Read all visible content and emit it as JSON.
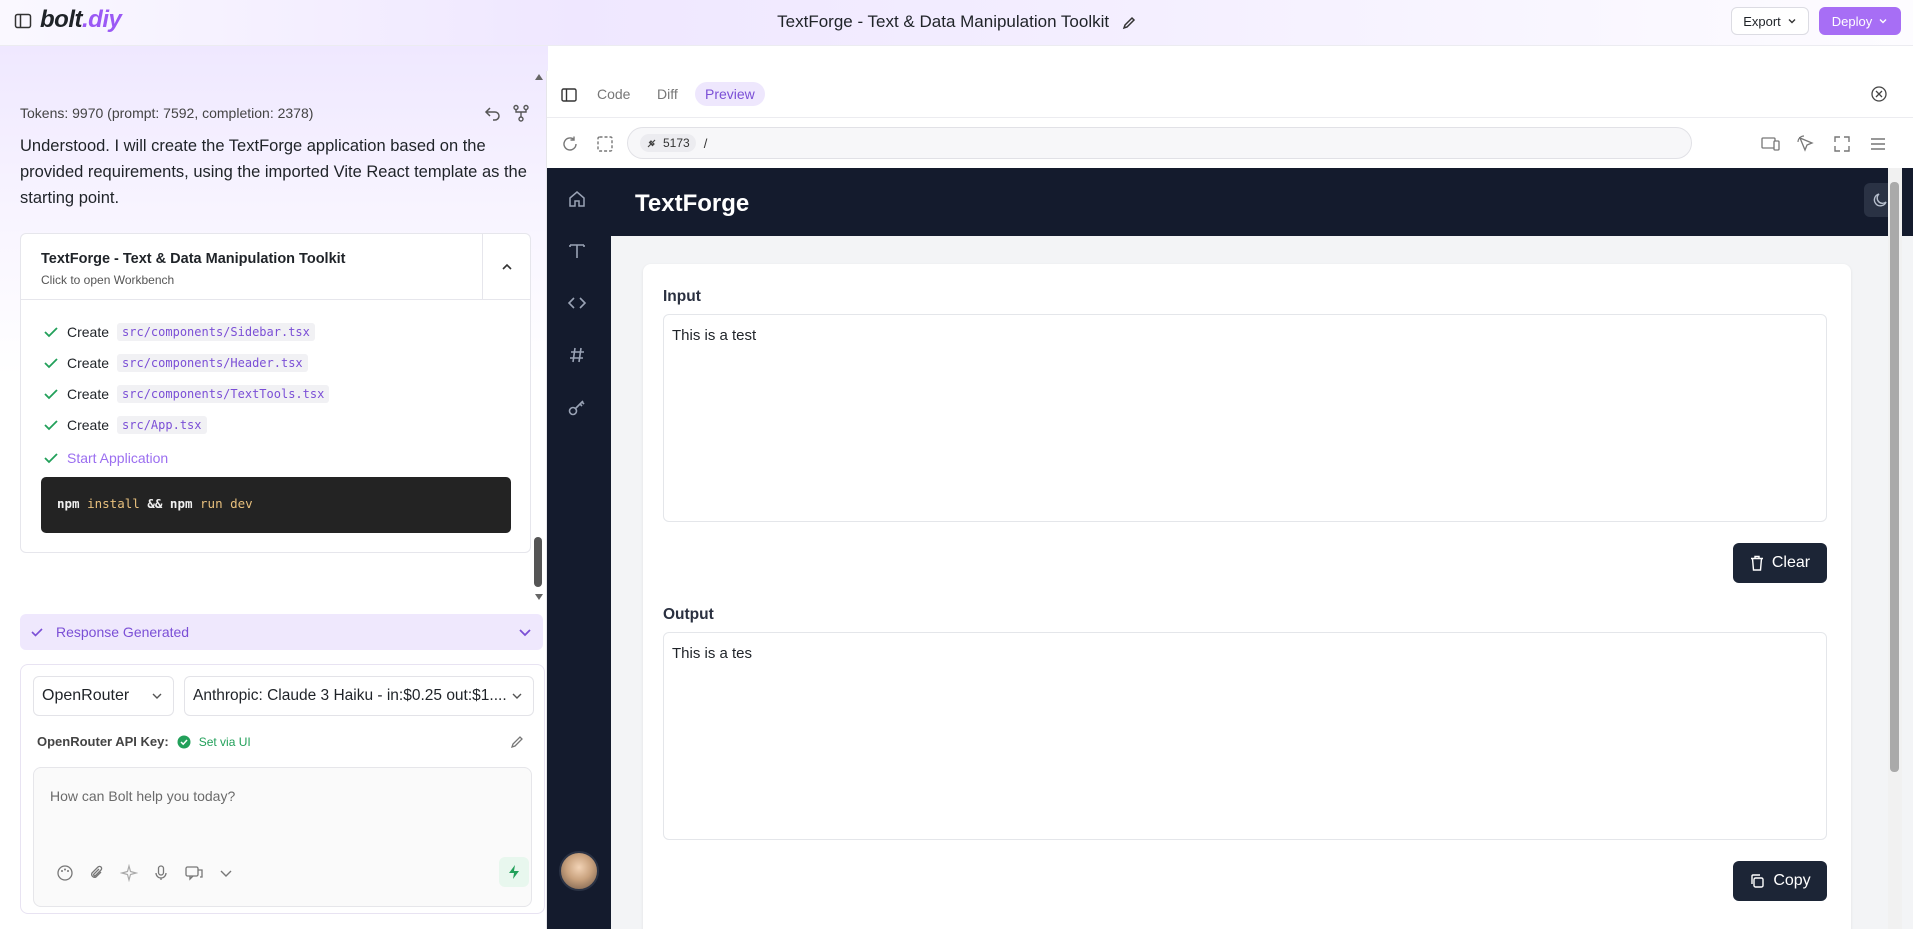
{
  "header": {
    "logo": "bolt.diy",
    "title": "TextForge - Text & Data Manipulation Toolkit",
    "export_label": "Export",
    "deploy_label": "Deploy"
  },
  "chat": {
    "tokens": "Tokens: 9970 (prompt: 7592, completion: 2378)",
    "message": "Understood. I will create the TextForge application based on the provided requirements, using the imported Vite React template as the starting point.",
    "artifact": {
      "title": "TextForge - Text & Data Manipulation Toolkit",
      "subtitle": "Click to open Workbench",
      "steps": [
        {
          "action": "Create",
          "file": "src/components/Sidebar.tsx"
        },
        {
          "action": "Create",
          "file": "src/components/Header.tsx"
        },
        {
          "action": "Create",
          "file": "src/components/TextTools.tsx"
        },
        {
          "action": "Create",
          "file": "src/App.tsx"
        }
      ],
      "start_label": "Start Application",
      "command": {
        "npm1": "npm",
        "install": "install",
        "amp": "&&",
        "npm2": "npm",
        "run": "run dev"
      }
    },
    "response_status": "Response Generated",
    "provider": "OpenRouter",
    "model": "Anthropic: Claude 3 Haiku - in:$0.25 out:$1....",
    "api_key_label": "OpenRouter API Key:",
    "api_key_status": "Set via UI",
    "input_placeholder": "How can Bolt help you today?"
  },
  "workbench": {
    "tabs": [
      "Code",
      "Diff",
      "Preview"
    ],
    "active_tab": "Preview",
    "port": "5173",
    "path": "/"
  },
  "preview": {
    "app_title": "TextForge",
    "input_label": "Input",
    "input_value": "This is a test",
    "clear_label": "Clear",
    "output_label": "Output",
    "output_value": "This is a tes",
    "copy_label": "Copy"
  },
  "colors": {
    "accent": "#a76ef5",
    "app_dark": "#141b2d",
    "success": "#22a05a"
  }
}
